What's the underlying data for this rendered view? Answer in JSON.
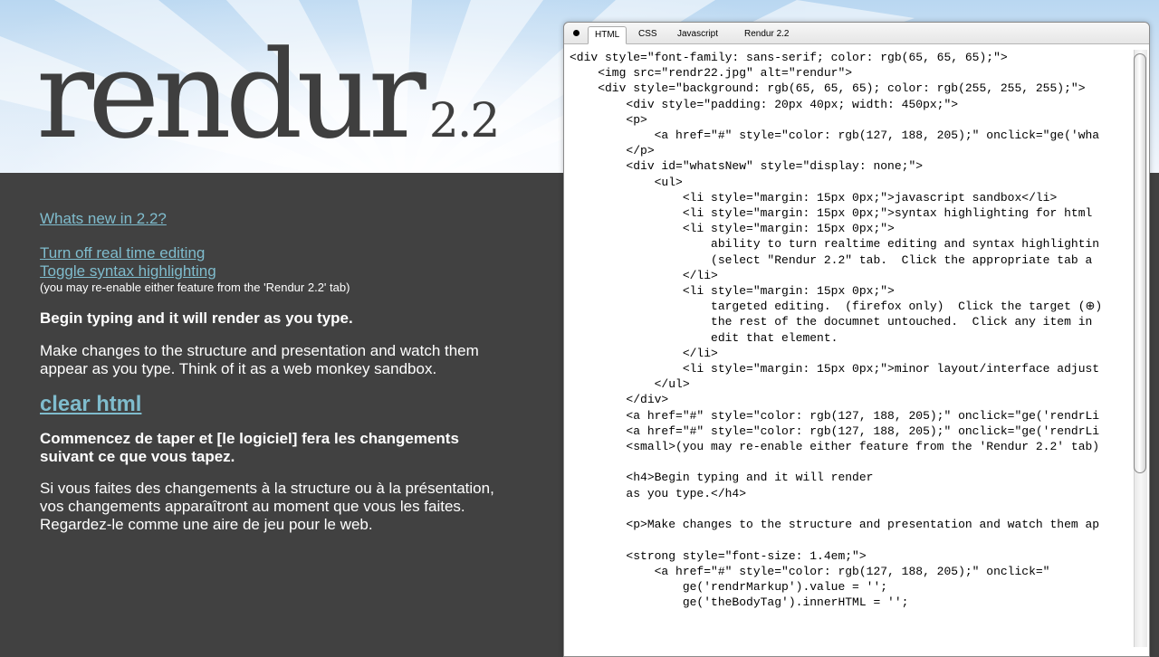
{
  "hero": {
    "logo_word": "rendur",
    "logo_version": "2.2"
  },
  "left": {
    "whats_new_link": "Whats new in 2.2?",
    "toggle_realtime_link": "Turn off real time editing",
    "toggle_syntax_link": "Toggle syntax highlighting",
    "reenable_note": "(you may re-enable either feature from the 'Rendur 2.2' tab)",
    "heading_en": "Begin typing and it will render as you type.",
    "para_en": "Make changes to the structure and presentation and watch them appear as you type. Think of it as a web monkey sandbox.",
    "clear_html_link": "clear html",
    "heading_fr": "Commencez de taper et [le logiciel] fera les changements suivant ce que vous tapez.",
    "para_fr": "Si vous faites des changements à la structure ou à la présentation, vos changements apparaîtront au moment que vous les faites. Regardez-le comme une aire de jeu pour le web."
  },
  "editor": {
    "tabs": [
      "HTML",
      "CSS",
      "Javascript",
      "Rendur 2.2"
    ],
    "active_tab": "HTML",
    "code_lines": [
      "<div style=\"font-family: sans-serif; color: rgb(65, 65, 65);\">",
      "    <img src=\"rendr22.jpg\" alt=\"rendur\">",
      "    <div style=\"background: rgb(65, 65, 65); color: rgb(255, 255, 255);\">",
      "        <div style=\"padding: 20px 40px; width: 450px;\">",
      "        <p>",
      "            <a href=\"#\" style=\"color: rgb(127, 188, 205);\" onclick=\"ge('wha",
      "        </p>",
      "        <div id=\"whatsNew\" style=\"display: none;\">",
      "            <ul>",
      "                <li style=\"margin: 15px 0px;\">javascript sandbox</li>",
      "                <li style=\"margin: 15px 0px;\">syntax highlighting for html",
      "                <li style=\"margin: 15px 0px;\">",
      "                    ability to turn realtime editing and syntax highlightin",
      "                    (select \"Rendur 2.2\" tab.  Click the appropriate tab a",
      "                </li>",
      "                <li style=\"margin: 15px 0px;\">",
      "                    targeted editing.  (firefox only)  Click the target (⊕)",
      "                    the rest of the documnet untouched.  Click any item in",
      "                    edit that element.",
      "                </li>",
      "                <li style=\"margin: 15px 0px;\">minor layout/interface adjust",
      "            </ul>",
      "        </div>",
      "        <a href=\"#\" style=\"color: rgb(127, 188, 205);\" onclick=\"ge('rendrLi",
      "        <a href=\"#\" style=\"color: rgb(127, 188, 205);\" onclick=\"ge('rendrLi",
      "        <small>(you may re-enable either feature from the 'Rendur 2.2' tab)",
      "",
      "        <h4>Begin typing and it will render",
      "        as you type.</h4>",
      "",
      "        <p>Make changes to the structure and presentation and watch them ap",
      "",
      "        <strong style=\"font-size: 1.4em;\">",
      "            <a href=\"#\" style=\"color: rgb(127, 188, 205);\" onclick=\"",
      "                ge('rendrMarkup').value = '';",
      "                ge('theBodyTag').innerHTML = '';"
    ]
  },
  "colors": {
    "background": "#414141",
    "link": "#7fbccd",
    "text": "#ffffff",
    "logo": "#3f3f3f"
  }
}
